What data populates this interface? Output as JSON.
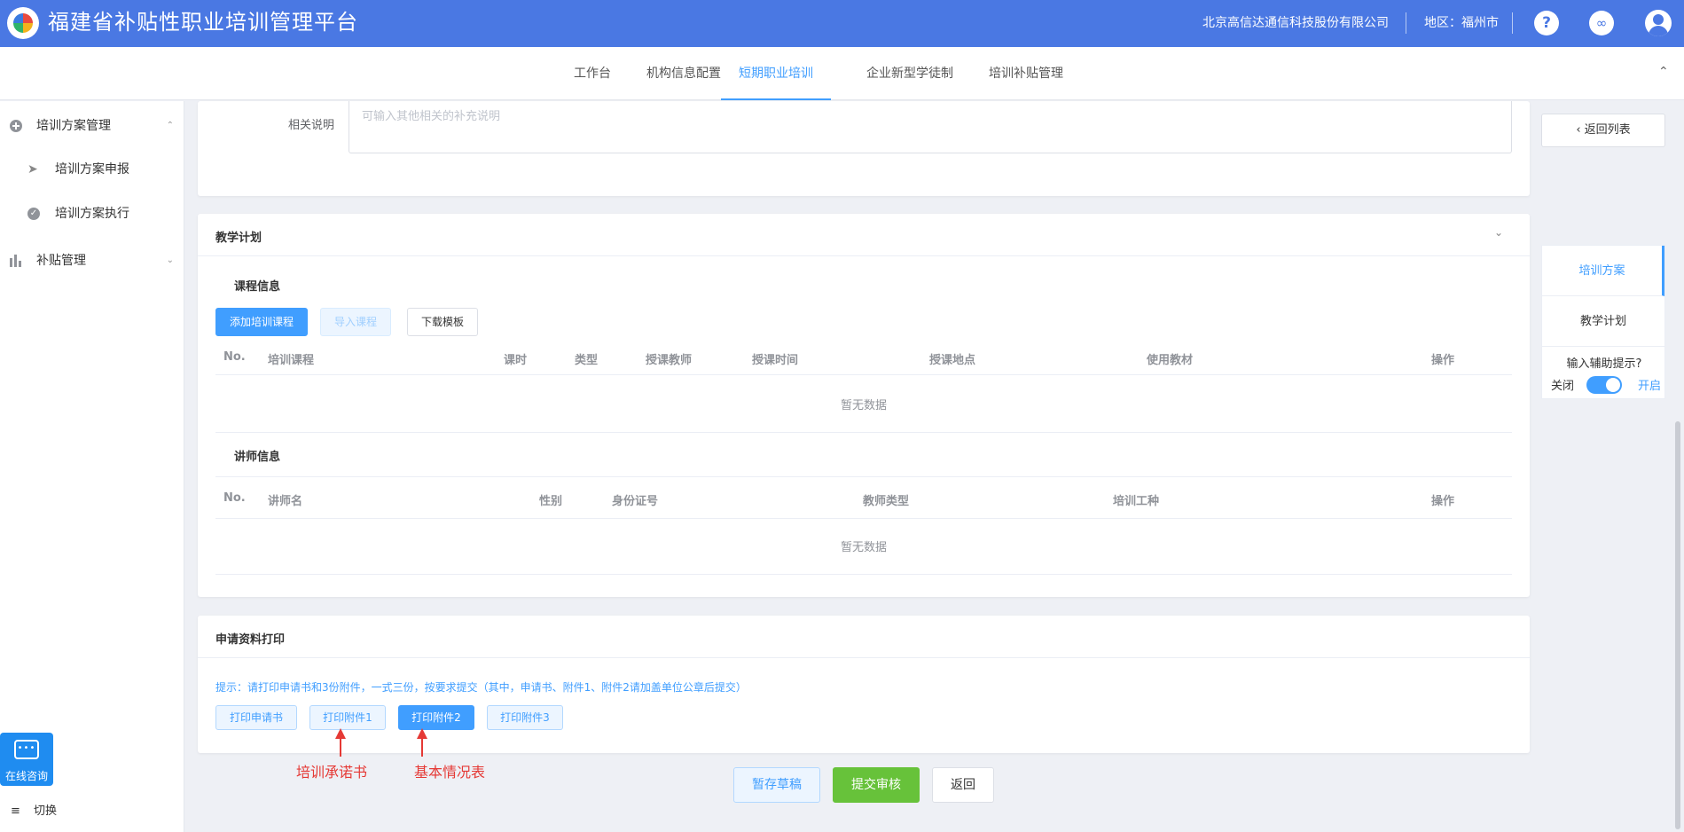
{
  "header": {
    "app_title": "福建省补贴性职业培训管理平台",
    "company": "北京高信达通信科技股份有限公司",
    "region": "地区：福州市",
    "icons": [
      "logo-icon",
      "help-icon",
      "link-icon",
      "user-avatar-icon"
    ]
  },
  "nav": {
    "tabs": [
      {
        "label": "工作台"
      },
      {
        "label": "机构信息配置"
      },
      {
        "label": "短期职业培训"
      },
      {
        "label": "企业新型学徒制"
      },
      {
        "label": "培训补贴管理"
      }
    ],
    "active": "短期职业培训"
  },
  "sidebar": {
    "items": [
      {
        "label": "培训方案管理"
      },
      {
        "label": "培训方案申报"
      },
      {
        "label": "培训方案执行"
      },
      {
        "label": "补贴管理"
      }
    ],
    "chat_label": "在线咨询",
    "switch_label": "切换"
  },
  "related": {
    "label": "相关说明",
    "placeholder": "可输入其他相关的补充说明"
  },
  "teaching": {
    "title": "教学计划",
    "course_title": "课程信息",
    "buttons": {
      "add": "添加培训课程",
      "import": "导入课程",
      "download": "下载模板"
    },
    "course_columns": [
      "No.",
      "培训课程",
      "课时",
      "类型",
      "授课教师",
      "授课时间",
      "授课地点",
      "使用教材",
      "操作"
    ],
    "empty": "暂无数据",
    "teacher_title": "讲师信息",
    "teacher_columns": [
      "No.",
      "讲师名",
      "性别",
      "身份证号",
      "教师类型",
      "培训工种",
      "操作"
    ]
  },
  "print": {
    "title": "申请资料打印",
    "hint": "提示：请打印申请书和3份附件，一式三份，按要求提交（其中，申请书、附件1、附件2请加盖单位公章后提交）",
    "buttons": [
      "打印申请书",
      "打印附件1",
      "打印附件2",
      "打印附件3"
    ],
    "annotations": [
      "培训承诺书",
      "基本情况表"
    ]
  },
  "footer": {
    "draft": "暂存草稿",
    "submit": "提交审核",
    "back": "返回"
  },
  "right": {
    "back_list": "返回列表",
    "anchors": [
      "培训方案",
      "教学计划"
    ],
    "assist_question": "输入辅助提示?",
    "off": "关闭",
    "on": "开启",
    "assist_enabled": true
  },
  "colors": {
    "header": "#4a78e3",
    "primary": "#409eff",
    "success": "#67c23a",
    "annotation": "#e53935"
  }
}
